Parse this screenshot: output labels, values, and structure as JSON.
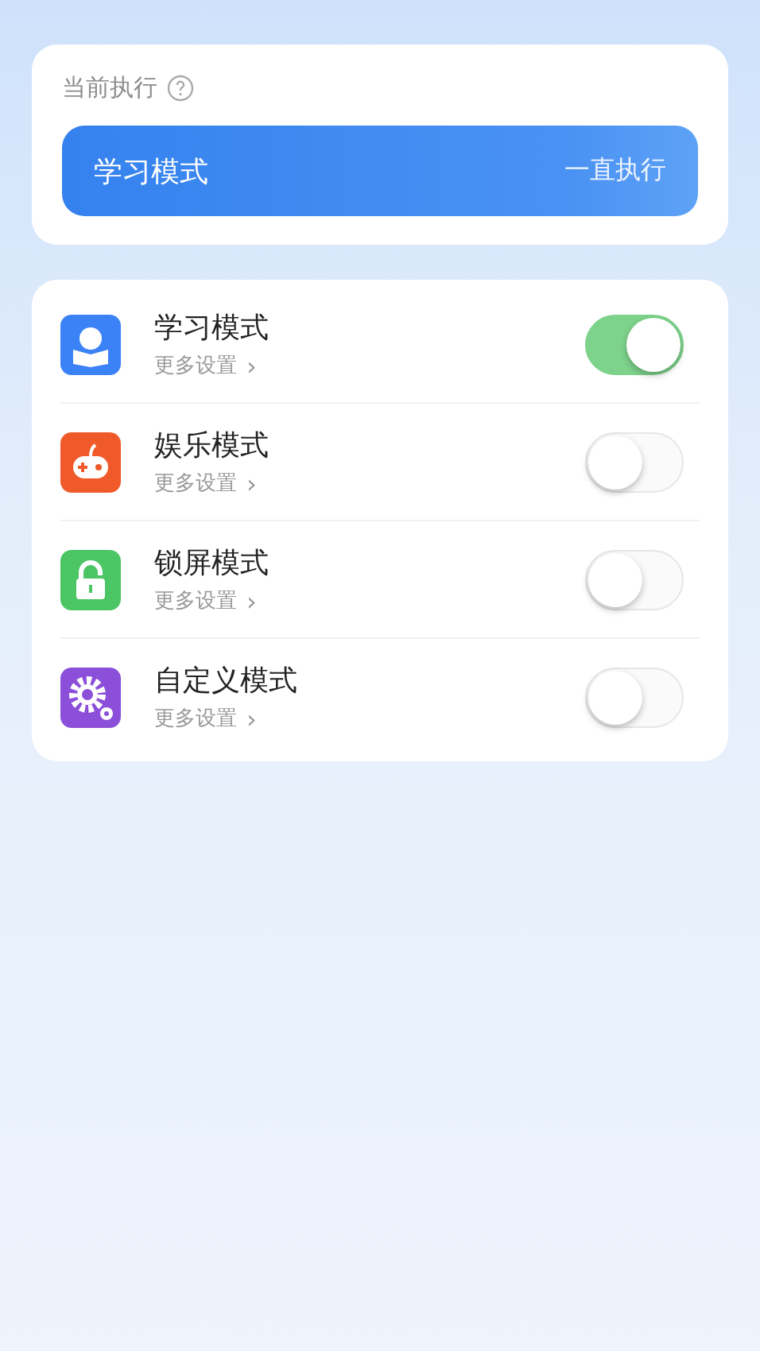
{
  "current": {
    "label": "当前执行",
    "mode": "学习模式",
    "duration": "一直执行"
  },
  "modes": [
    {
      "kind": "study",
      "color": "#3b82f6",
      "name": "学习模式",
      "more": "更多设置",
      "chevron": "›",
      "on": true
    },
    {
      "kind": "game",
      "color": "#f05a2a",
      "name": "娱乐模式",
      "more": "更多设置",
      "chevron": "›",
      "on": false
    },
    {
      "kind": "lock",
      "color": "#4cc565",
      "name": "锁屏模式",
      "more": "更多设置",
      "chevron": "›",
      "on": false
    },
    {
      "kind": "custom",
      "color": "#8b4fd9",
      "name": "自定义模式",
      "more": "更多设置",
      "chevron": "›",
      "on": false
    }
  ]
}
